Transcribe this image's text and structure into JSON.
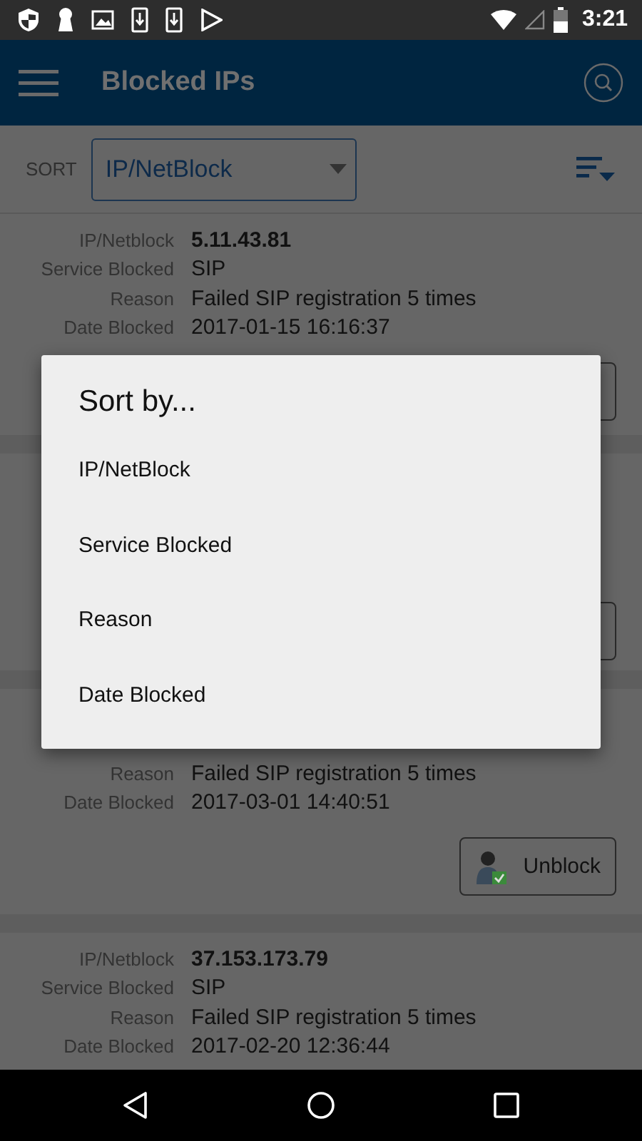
{
  "status_bar": {
    "time": "3:21"
  },
  "app_bar": {
    "title": "Blocked IPs"
  },
  "sort": {
    "label": "SORT",
    "value": "IP/NetBlock"
  },
  "cards": [
    {
      "kind": "with_button",
      "fields": [
        {
          "label": "IP/Netblock",
          "value": "5.11.43.81",
          "kind": "ip"
        },
        {
          "label": "Service Blocked",
          "value": "SIP",
          "kind": "text"
        },
        {
          "label": "Reason",
          "value": "Failed SIP registration 5 times",
          "kind": "text"
        },
        {
          "label": "Date Blocked",
          "value": "2017-01-15 16:16:37",
          "kind": "text"
        }
      ]
    },
    {
      "kind": "with_button"
    },
    {
      "kind": "with_button",
      "fields": [
        {
          "label": "Reason",
          "value": "Failed SIP registration 5 times",
          "kind": "text"
        },
        {
          "label": "Date Blocked",
          "value": "2017-03-01 14:40:51",
          "kind": "text"
        }
      ],
      "button_label": "Unblock"
    },
    {
      "kind": "plain",
      "fields": [
        {
          "label": "IP/Netblock",
          "value": "37.153.173.79",
          "kind": "ip"
        },
        {
          "label": "Service Blocked",
          "value": "SIP",
          "kind": "text"
        },
        {
          "label": "Reason",
          "value": "Failed SIP registration 5 times",
          "kind": "text"
        },
        {
          "label": "Date Blocked",
          "value": "2017-02-20 12:36:44",
          "kind": "text"
        }
      ]
    }
  ],
  "dialog": {
    "title": "Sort by...",
    "options": [
      {
        "label": "IP/NetBlock"
      },
      {
        "label": "Service Blocked"
      },
      {
        "label": "Reason"
      },
      {
        "label": "Date Blocked"
      }
    ]
  }
}
